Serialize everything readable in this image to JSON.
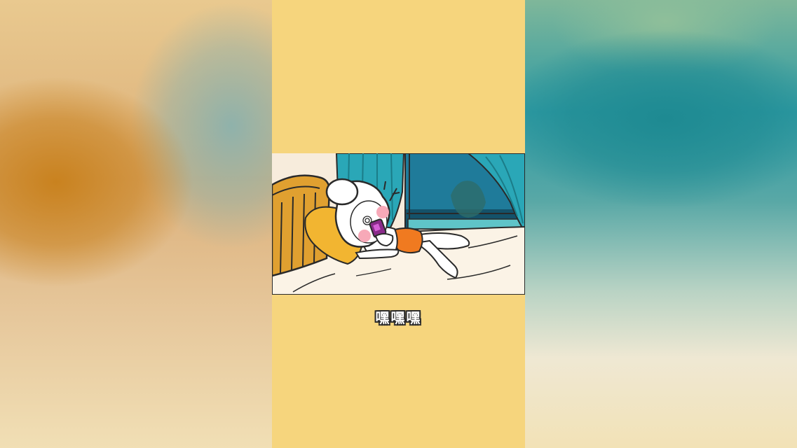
{
  "caption": "嘿嘿嘿",
  "colors": {
    "frame_background": "#f6d57d",
    "wall": "#f7ecdc",
    "curtain": "#2aa7b7",
    "window_sky": "#1f7b9a",
    "bed_sheet": "#fbf3e6",
    "headboard": "#e0a030",
    "shorts": "#f07a20",
    "phone": "#8a2a8a",
    "cheeks": "#f7a9b8"
  },
  "icons": [
    "character-sleeping",
    "phone-icon"
  ]
}
